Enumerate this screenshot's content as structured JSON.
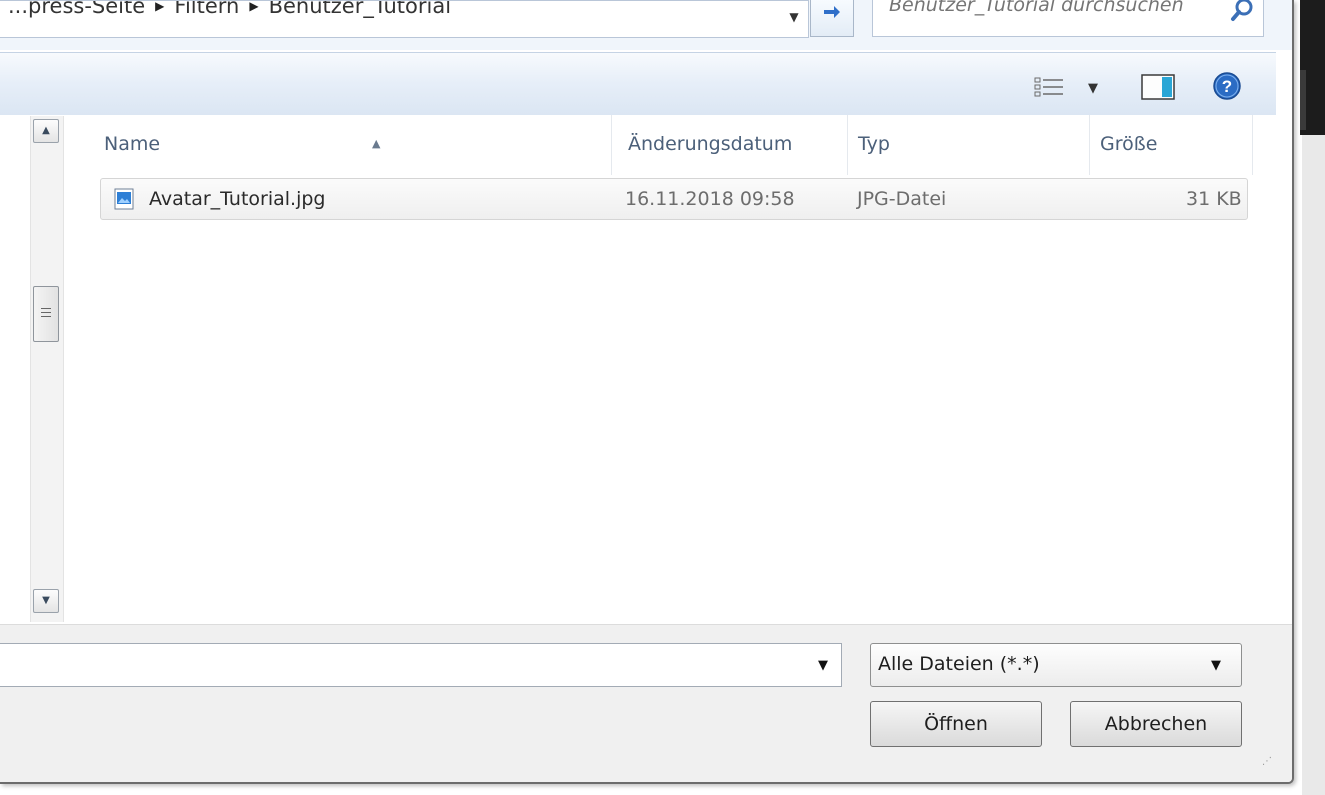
{
  "address_bar": {
    "breadcrumb": [
      "...press-Seite",
      "Filtern",
      "Benutzer_Tutorial"
    ]
  },
  "search": {
    "placeholder": "Benutzer_Tutorial durchsuchen"
  },
  "toolbar": {
    "icons": [
      "view-options-icon",
      "dropdown-arrow-icon",
      "preview-pane-icon",
      "help-icon"
    ]
  },
  "file_list": {
    "columns": {
      "name": "Name",
      "date": "Änderungsdatum",
      "type": "Typ",
      "size": "Größe"
    },
    "rows": [
      {
        "name": "Avatar_Tutorial.jpg",
        "date": "16.11.2018 09:58",
        "type": "JPG-Datei",
        "size": "31 KB"
      }
    ]
  },
  "bottom": {
    "filename_value": "",
    "filetype_selected": "Alle Dateien (*.*)",
    "open_label": "Öffnen",
    "cancel_label": "Abbrechen"
  },
  "colors": {
    "toolbar_gradient_top": "#f7fafd",
    "toolbar_gradient_bottom": "#dbe6f3",
    "header_text": "#4c607a",
    "help_blue": "#2b6cc4"
  }
}
